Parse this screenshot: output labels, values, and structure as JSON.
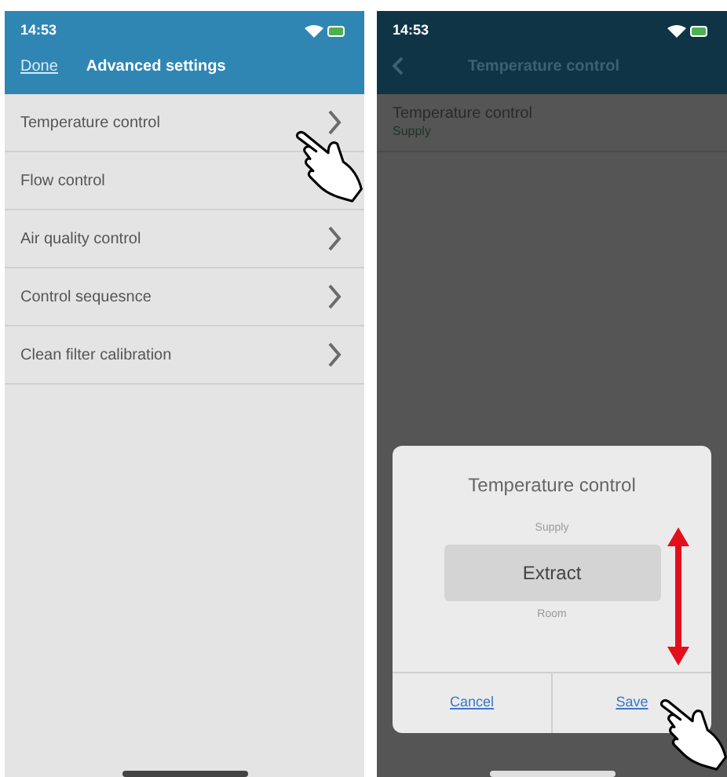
{
  "left_screen": {
    "status_bar": {
      "time": "14:53"
    },
    "nav_bar": {
      "back": "Done",
      "title": "Advanced settings"
    },
    "items": [
      {
        "label": "Temperature control"
      },
      {
        "label": "Flow control"
      },
      {
        "label": "Air quality control"
      },
      {
        "label": "Control sequesnce"
      },
      {
        "label": "Clean filter calibration"
      }
    ]
  },
  "right_screen": {
    "status_bar": {
      "time": "14:53"
    },
    "nav_bar": {
      "title": "Temperature control"
    },
    "setting": {
      "label": "Temperature control",
      "value": "Supply"
    },
    "dialog": {
      "title": "Temperature control",
      "options": [
        {
          "label": "Supply",
          "selected": false
        },
        {
          "label": "Extract",
          "selected": true
        },
        {
          "label": "Room",
          "selected": false
        }
      ],
      "buttons": [
        "Cancel",
        "Save"
      ]
    }
  }
}
